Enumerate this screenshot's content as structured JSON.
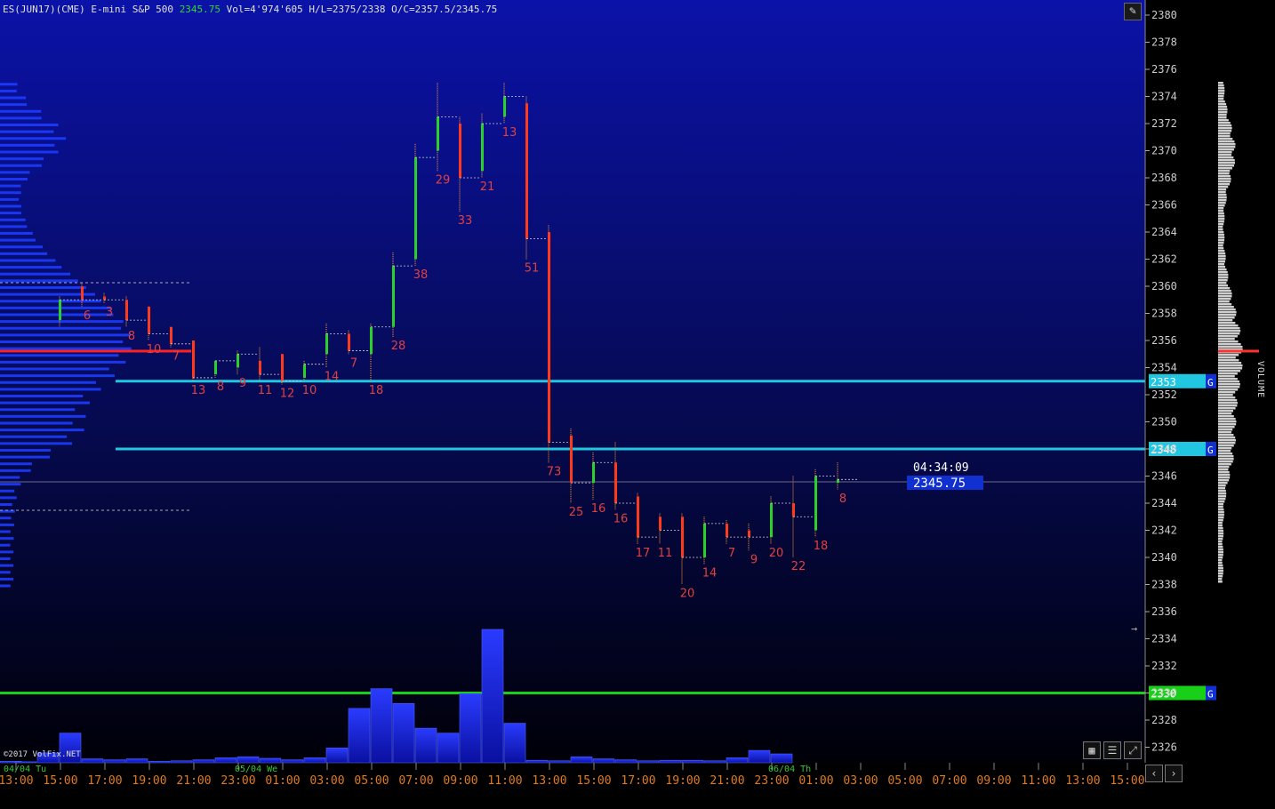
{
  "header": {
    "symbol": "ES(JUN17)(CME) E-mini S&P 500",
    "last_price": "2345.75",
    "stats": "Vol=4'974'605 H/L=2375/2338 O/C=2357.5/2345.75"
  },
  "copyright": "©2017 VolFix.NET",
  "volume_label": "VOLUME",
  "countdown": "04:34:09",
  "price_tag": "2345.75",
  "colors": {
    "bg_top": "#0a10a0",
    "bg_bottom": "#000010",
    "up": "#2bd02b",
    "down": "#ff3a1a",
    "level": "#21c6e0",
    "green_level": "#19d019",
    "label": "#e04040"
  },
  "chart_data": {
    "type": "candlestick",
    "price_axis": {
      "min": 2325,
      "max": 2381,
      "ticks": [
        2326,
        2328,
        2330,
        2332,
        2334,
        2336,
        2338,
        2340,
        2342,
        2344,
        2346,
        2348,
        2350,
        2352,
        2354,
        2356,
        2358,
        2360,
        2362,
        2364,
        2366,
        2368,
        2370,
        2372,
        2374,
        2376,
        2378,
        2380
      ]
    },
    "time_axis": [
      "13:00",
      "15:00",
      "17:00",
      "19:00",
      "21:00",
      "23:00",
      "01:00",
      "03:00",
      "05:00",
      "07:00",
      "09:00",
      "11:00",
      "13:00",
      "15:00",
      "17:00",
      "19:00",
      "21:00",
      "23:00",
      "01:00",
      "03:00",
      "05:00",
      "07:00",
      "09:00",
      "11:00",
      "13:00",
      "15:00"
    ],
    "date_labels": [
      {
        "label": "04/04 Tu",
        "at": 0
      },
      {
        "label": "05/04 We",
        "at": 5
      },
      {
        "label": "06/04 Th",
        "at": 17
      }
    ],
    "bars": [
      {
        "o": 2357.5,
        "h": 2359.25,
        "l": 2357,
        "c": 2359,
        "n": ""
      },
      {
        "o": 2360,
        "h": 2360.25,
        "l": 2358.5,
        "c": 2359,
        "n": "6"
      },
      {
        "o": 2359.25,
        "h": 2359.5,
        "l": 2358.75,
        "c": 2359,
        "n": "3"
      },
      {
        "o": 2359,
        "h": 2359.25,
        "l": 2357,
        "c": 2357.5,
        "n": "8"
      },
      {
        "o": 2358.5,
        "h": 2358.5,
        "l": 2356,
        "c": 2356.5,
        "n": "10"
      },
      {
        "o": 2357,
        "h": 2357,
        "l": 2355.5,
        "c": 2355.75,
        "n": "7"
      },
      {
        "o": 2356,
        "h": 2356,
        "l": 2353,
        "c": 2353.25,
        "n": "13"
      },
      {
        "o": 2353.5,
        "h": 2354.5,
        "l": 2353.25,
        "c": 2354.5,
        "n": "8"
      },
      {
        "o": 2354,
        "h": 2355.25,
        "l": 2353.5,
        "c": 2355,
        "n": "9"
      },
      {
        "o": 2354.5,
        "h": 2355.5,
        "l": 2353,
        "c": 2353.5,
        "n": "11"
      },
      {
        "o": 2355,
        "h": 2355,
        "l": 2352.75,
        "c": 2353,
        "n": "12"
      },
      {
        "o": 2353.25,
        "h": 2354.5,
        "l": 2353,
        "c": 2354.25,
        "n": "10"
      },
      {
        "o": 2355,
        "h": 2357.25,
        "l": 2354,
        "c": 2356.5,
        "n": "14"
      },
      {
        "o": 2356.5,
        "h": 2356.75,
        "l": 2355,
        "c": 2355.25,
        "n": "7"
      },
      {
        "o": 2355,
        "h": 2357.25,
        "l": 2353,
        "c": 2357,
        "n": "18"
      },
      {
        "o": 2357,
        "h": 2362.5,
        "l": 2356.25,
        "c": 2361.5,
        "n": "28"
      },
      {
        "o": 2362,
        "h": 2370.5,
        "l": 2361.5,
        "c": 2369.5,
        "n": "38"
      },
      {
        "o": 2370,
        "h": 2375,
        "l": 2368.5,
        "c": 2372.5,
        "n": "29"
      },
      {
        "o": 2372,
        "h": 2372.5,
        "l": 2365.5,
        "c": 2368,
        "n": "33"
      },
      {
        "o": 2368.5,
        "h": 2372.75,
        "l": 2368,
        "c": 2372,
        "n": "21"
      },
      {
        "o": 2372.5,
        "h": 2375,
        "l": 2372,
        "c": 2374,
        "n": "13"
      },
      {
        "o": 2373.5,
        "h": 2374,
        "l": 2362,
        "c": 2363.5,
        "n": "51"
      },
      {
        "o": 2364,
        "h": 2364.5,
        "l": 2347,
        "c": 2348.5,
        "n": "73"
      },
      {
        "o": 2349,
        "h": 2349.5,
        "l": 2344,
        "c": 2345.5,
        "n": "25"
      },
      {
        "o": 2345.5,
        "h": 2347.75,
        "l": 2344.25,
        "c": 2347,
        "n": "16"
      },
      {
        "o": 2347,
        "h": 2348.5,
        "l": 2343.5,
        "c": 2344,
        "n": "16"
      },
      {
        "o": 2344.5,
        "h": 2344.75,
        "l": 2341,
        "c": 2341.5,
        "n": "17"
      },
      {
        "o": 2343,
        "h": 2343.25,
        "l": 2341,
        "c": 2342,
        "n": "11"
      },
      {
        "o": 2343,
        "h": 2343.25,
        "l": 2338,
        "c": 2340,
        "n": "20"
      },
      {
        "o": 2340,
        "h": 2343,
        "l": 2339.5,
        "c": 2342.5,
        "n": "14"
      },
      {
        "o": 2342.5,
        "h": 2342.75,
        "l": 2341,
        "c": 2341.5,
        "n": "7"
      },
      {
        "o": 2342,
        "h": 2342.5,
        "l": 2340.5,
        "c": 2341.5,
        "n": "9"
      },
      {
        "o": 2341.5,
        "h": 2344.5,
        "l": 2341,
        "c": 2344,
        "n": "20"
      },
      {
        "o": 2344,
        "h": 2346,
        "l": 2340,
        "c": 2343,
        "n": "22"
      },
      {
        "o": 2342,
        "h": 2346.5,
        "l": 2341.5,
        "c": 2346,
        "n": "18"
      },
      {
        "o": 2345.5,
        "h": 2347,
        "l": 2345,
        "c": 2345.75,
        "n": "8"
      }
    ],
    "volume": [
      3,
      2,
      20,
      60,
      8,
      6,
      8,
      3,
      4,
      6,
      10,
      12,
      9,
      6,
      10,
      30,
      110,
      150,
      120,
      70,
      60,
      140,
      270,
      80,
      5,
      4,
      12,
      8,
      6,
      4,
      5,
      5,
      4,
      10,
      25,
      18
    ],
    "levels": [
      {
        "price": 2353,
        "label": "2353",
        "tag": "G"
      },
      {
        "price": 2348,
        "label": "2348",
        "tag": "G"
      },
      {
        "price": 2330,
        "label": "2330",
        "tag": "G"
      }
    ],
    "poc_price": 2355.25
  }
}
